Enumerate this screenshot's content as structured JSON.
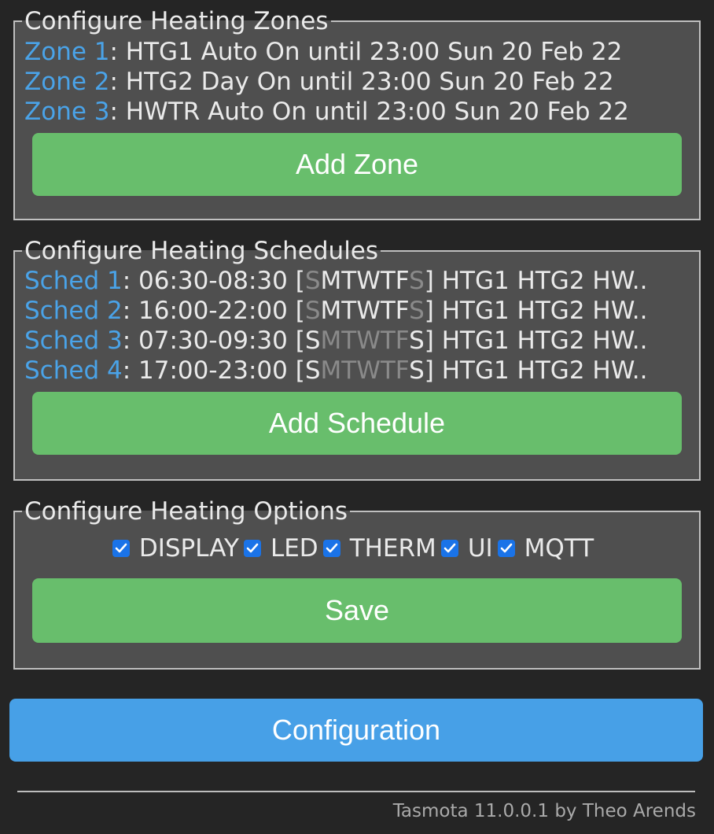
{
  "zones": {
    "legend": "Configure Heating Zones",
    "items": [
      {
        "link": "Zone 1",
        "text": ": HTG1 Auto On until 23:00 Sun 20 Feb 22"
      },
      {
        "link": "Zone 2",
        "text": ": HTG2 Day On until 23:00 Sun 20 Feb 22"
      },
      {
        "link": "Zone 3",
        "text": ": HWTR Auto On until 23:00 Sun 20 Feb 22"
      }
    ],
    "add_label": "Add Zone"
  },
  "schedules": {
    "legend": "Configure Heating Schedules",
    "items": [
      {
        "link": "Sched 1",
        "times": ": 06:30-08:30 [",
        "days": [
          {
            "d": "S",
            "on": false
          },
          {
            "d": "M",
            "on": true
          },
          {
            "d": "T",
            "on": true
          },
          {
            "d": "W",
            "on": true
          },
          {
            "d": "T",
            "on": true
          },
          {
            "d": "F",
            "on": true
          },
          {
            "d": "S",
            "on": false
          }
        ],
        "targets": "] HTG1 HTG2 HW.."
      },
      {
        "link": "Sched 2",
        "times": ": 16:00-22:00 [",
        "days": [
          {
            "d": "S",
            "on": false
          },
          {
            "d": "M",
            "on": true
          },
          {
            "d": "T",
            "on": true
          },
          {
            "d": "W",
            "on": true
          },
          {
            "d": "T",
            "on": true
          },
          {
            "d": "F",
            "on": true
          },
          {
            "d": "S",
            "on": false
          }
        ],
        "targets": "] HTG1 HTG2 HW.."
      },
      {
        "link": "Sched 3",
        "times": ": 07:30-09:30 [",
        "days": [
          {
            "d": "S",
            "on": true
          },
          {
            "d": "M",
            "on": false
          },
          {
            "d": "T",
            "on": false
          },
          {
            "d": "W",
            "on": false
          },
          {
            "d": "T",
            "on": false
          },
          {
            "d": "F",
            "on": false
          },
          {
            "d": "S",
            "on": true
          }
        ],
        "targets": "] HTG1 HTG2 HW.."
      },
      {
        "link": "Sched 4",
        "times": ": 17:00-23:00 [",
        "days": [
          {
            "d": "S",
            "on": true
          },
          {
            "d": "M",
            "on": false
          },
          {
            "d": "T",
            "on": false
          },
          {
            "d": "W",
            "on": false
          },
          {
            "d": "T",
            "on": false
          },
          {
            "d": "F",
            "on": false
          },
          {
            "d": "S",
            "on": true
          }
        ],
        "targets": "] HTG1 HTG2 HW.."
      }
    ],
    "add_label": "Add Schedule"
  },
  "options": {
    "legend": "Configure Heating Options",
    "checkboxes": [
      {
        "label": "DISPLAY",
        "checked": true
      },
      {
        "label": "LED",
        "checked": true
      },
      {
        "label": "THERM",
        "checked": true
      },
      {
        "label": "UI",
        "checked": true
      },
      {
        "label": "MQTT",
        "checked": true
      }
    ],
    "save_label": "Save"
  },
  "configuration_label": "Configuration",
  "footer": "Tasmota 11.0.0.1 by Theo Arends",
  "colors": {
    "link": "#4aa3e8",
    "button_green": "#68be6c",
    "button_blue": "#47a0e7",
    "checkbox": "#1a73e8",
    "dim_day": "#8a8a8a"
  },
  "icons": {
    "checkbox": "checkmark-icon"
  }
}
